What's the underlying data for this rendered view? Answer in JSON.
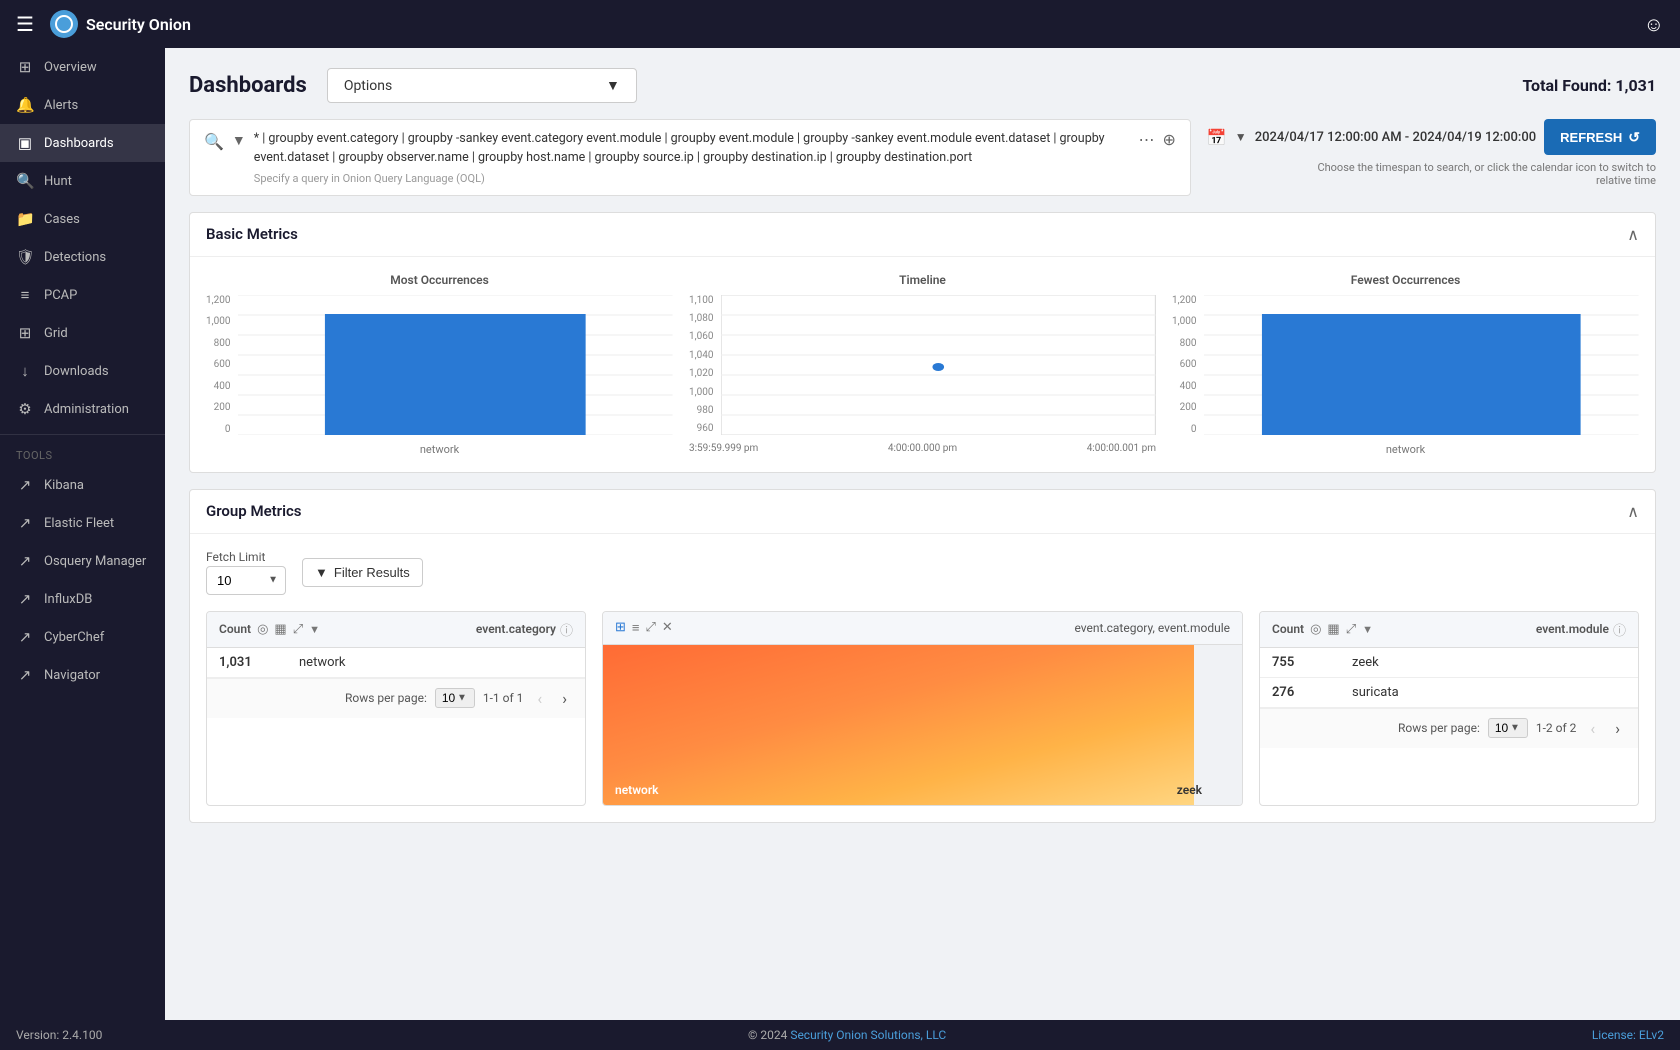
{
  "topbar": {
    "logo_text": "Security Onion",
    "hamburger": "☰",
    "user_icon": "👤"
  },
  "sidebar": {
    "items": [
      {
        "id": "overview",
        "label": "Overview",
        "icon": "⊞"
      },
      {
        "id": "alerts",
        "label": "Alerts",
        "icon": "🔔"
      },
      {
        "id": "dashboards",
        "label": "Dashboards",
        "icon": "◫",
        "active": true
      },
      {
        "id": "hunt",
        "label": "Hunt",
        "icon": "🔍"
      },
      {
        "id": "cases",
        "label": "Cases",
        "icon": "📁"
      },
      {
        "id": "detections",
        "label": "Detections",
        "icon": "🛡"
      },
      {
        "id": "pcap",
        "label": "PCAP",
        "icon": "≡"
      },
      {
        "id": "grid",
        "label": "Grid",
        "icon": "⊞"
      },
      {
        "id": "downloads",
        "label": "Downloads",
        "icon": "↓"
      },
      {
        "id": "administration",
        "label": "Administration",
        "icon": "⚙"
      }
    ],
    "tools_label": "Tools",
    "tools": [
      {
        "id": "kibana",
        "label": "Kibana",
        "icon": "↗"
      },
      {
        "id": "elastic-fleet",
        "label": "Elastic Fleet",
        "icon": "↗"
      },
      {
        "id": "osquery-manager",
        "label": "Osquery Manager",
        "icon": "↗"
      },
      {
        "id": "influxdb",
        "label": "InfluxDB",
        "icon": "↗"
      },
      {
        "id": "cyberchef",
        "label": "CyberChef",
        "icon": "↗"
      },
      {
        "id": "navigator",
        "label": "Navigator",
        "icon": "↗"
      }
    ]
  },
  "page": {
    "title": "Dashboards",
    "total_found": "Total Found: 1,031",
    "options_label": "Options"
  },
  "query": {
    "text": "* | groupby event.category | groupby -sankey event.category event.module | groupby event.module | groupby -sankey event.module event.dataset | groupby event.dataset | groupby observer.name | groupby host.name | groupby source.ip | groupby destination.ip | groupby destination.port",
    "hint": "Specify a query in Onion Query Language (OQL)"
  },
  "datetime": {
    "range": "2024/04/17 12:00:00 AM - 2024/04/19 12:00:00",
    "hint": "Choose the timespan to search, or click the calendar icon to switch to relative time",
    "refresh_label": "REFRESH"
  },
  "basic_metrics": {
    "title": "Basic Metrics",
    "most_occurrences": {
      "title": "Most Occurrences",
      "x_label": "network",
      "y_labels": [
        "1,200",
        "1,000",
        "800",
        "600",
        "400",
        "200",
        "0"
      ],
      "bar_value": 1031,
      "bar_max": 1200
    },
    "timeline": {
      "title": "Timeline",
      "y_labels": [
        "1,100",
        "1,080",
        "1,060",
        "1,040",
        "1,020",
        "1,000",
        "980",
        "960"
      ],
      "x_labels": [
        "3:59:59.999 pm",
        "4:00:00.000 pm",
        "4:00:00.001 pm"
      ]
    },
    "fewest_occurrences": {
      "title": "Fewest Occurrences",
      "x_label": "network",
      "y_labels": [
        "1,200",
        "1,000",
        "800",
        "600",
        "400",
        "200",
        "0"
      ],
      "bar_value": 1031,
      "bar_max": 1200
    }
  },
  "group_metrics": {
    "title": "Group Metrics",
    "fetch_limit_label": "Fetch Limit",
    "fetch_limit_value": "10",
    "filter_label": "Filter Results",
    "table1": {
      "col1": "Count",
      "col2": "event.category",
      "rows": [
        {
          "count": "1,031",
          "value": "network"
        }
      ],
      "rows_per_page_label": "Rows per page:",
      "rows_per_page": "10",
      "page_info": "1-1 of 1"
    },
    "table2": {
      "title": "event.category, event.module",
      "heatmap_label": "zeek",
      "heatmap_sublabel": "network"
    },
    "table3": {
      "col1": "Count",
      "col2": "event.module",
      "rows": [
        {
          "count": "755",
          "value": "zeek"
        },
        {
          "count": "276",
          "value": "suricata"
        }
      ],
      "rows_per_page_label": "Rows per page:",
      "rows_per_page": "10",
      "page_info": "1-2 of 2"
    }
  },
  "footer": {
    "version": "Version: 2.4.100",
    "copyright": "© 2024",
    "company": "Security Onion Solutions, LLC",
    "license": "License: ELv2"
  }
}
